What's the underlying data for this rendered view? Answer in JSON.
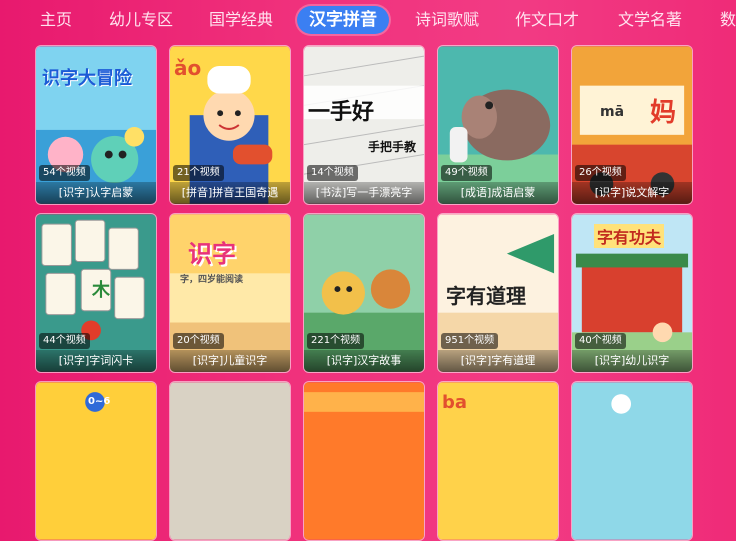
{
  "tabs": [
    "主页",
    "幼儿专区",
    "国学经典",
    "汉字拼音",
    "诗词歌赋",
    "作文口才",
    "文学名著",
    "数"
  ],
  "active_tab": "汉字拼音",
  "cards": [
    {
      "count": "54个视频",
      "title": "[识字]认字启蒙",
      "art": "识字大冒险"
    },
    {
      "count": "21个视频",
      "title": "[拼音]拼音王国奇遇",
      "art": "ǎo"
    },
    {
      "count": "14个视频",
      "title": "[书法]写一手漂亮字",
      "art": "一手好",
      "art2": "手把手教"
    },
    {
      "count": "49个视频",
      "title": "[成语]成语启蒙",
      "art": ""
    },
    {
      "count": "26个视频",
      "title": "[识字]说文解字",
      "art": "mā",
      "art2": "妈"
    },
    {
      "count": "44个视频",
      "title": "[识字]字词闪卡",
      "art": "木"
    },
    {
      "count": "20个视频",
      "title": "[识字]儿童识字",
      "art": "识字",
      "art2": "字，四岁能阅读"
    },
    {
      "count": "221个视频",
      "title": "[识字]汉字故事",
      "art": ""
    },
    {
      "count": "951个视频",
      "title": "[识字]字有道理",
      "art": "字有道理"
    },
    {
      "count": "40个视频",
      "title": "[识字]幼儿识字",
      "art": "字有功夫"
    },
    {
      "art": "0~6"
    },
    {
      "art": ""
    },
    {
      "art": ""
    },
    {
      "art": "ba"
    },
    {
      "art": ""
    }
  ]
}
